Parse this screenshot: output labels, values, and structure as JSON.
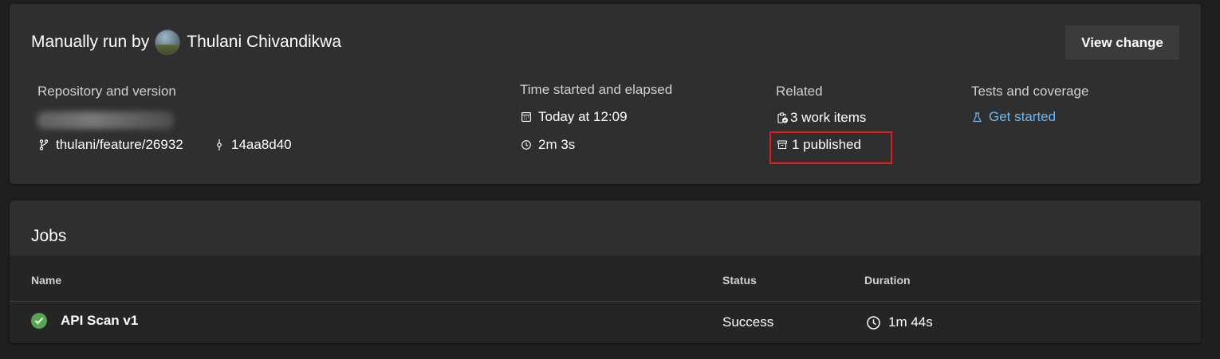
{
  "summary": {
    "run_by_label": "Manually run by",
    "user_name": "Thulani Chivandikwa",
    "view_change_label": "View change",
    "repository": {
      "title": "Repository and version",
      "branch": "thulani/feature/26932",
      "commit": "14aa8d40"
    },
    "time": {
      "title": "Time started and elapsed",
      "started": "Today at 12:09",
      "elapsed": "2m 3s"
    },
    "related": {
      "title": "Related",
      "work_items": "3 work items",
      "published": "1 published"
    },
    "tests": {
      "title": "Tests and coverage",
      "link": "Get started"
    }
  },
  "jobs": {
    "title": "Jobs",
    "columns": [
      "Name",
      "Status",
      "Duration"
    ],
    "rows": [
      {
        "name": "API Scan v1",
        "status": "Success",
        "duration": "1m 44s"
      }
    ]
  },
  "colors": {
    "background": "#1f1f1f",
    "card": "#2f2f2f",
    "link": "#6cb8f6",
    "success": "#54a74d",
    "highlight": "#e01c1c"
  }
}
